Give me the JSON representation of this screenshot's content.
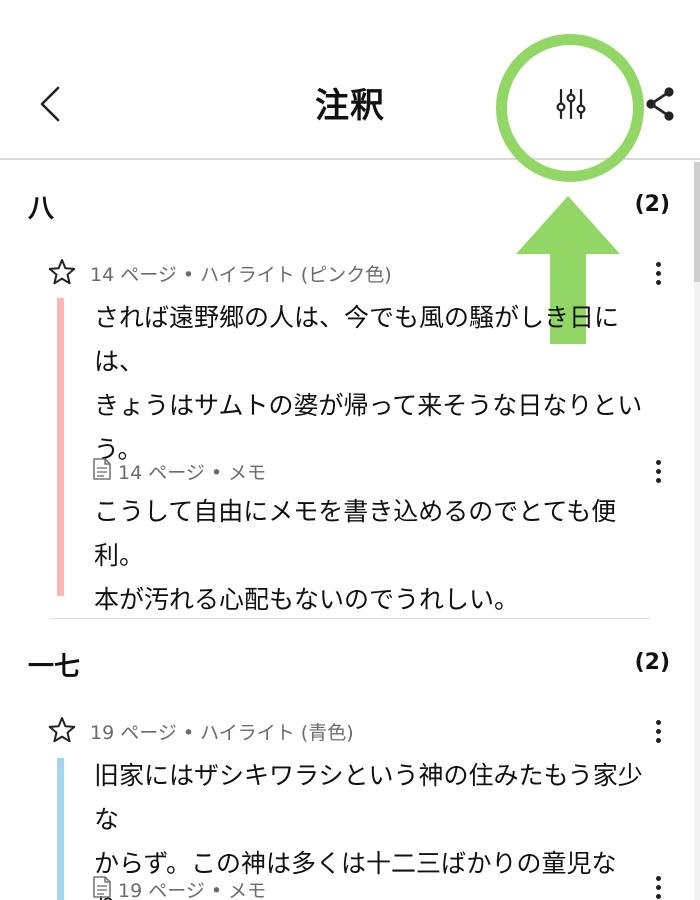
{
  "header": {
    "title": "注釈",
    "icons": {
      "back": "chevron-left-icon",
      "filter": "sliders-icon",
      "share": "share-icon"
    }
  },
  "annotation_overlay": {
    "ring_color": "#92d765",
    "arrow_color": "#92d765"
  },
  "sections": [
    {
      "name": "八",
      "count": "(2)",
      "highlight": {
        "meta": "14 ページ • ハイライト (ピンク色)",
        "color": "#ffb5b8",
        "lines": [
          "されば遠野郷の人は、今でも風の騒がしき日には、",
          "きょうはサムトの婆が帰って来そうな日なりとい",
          "う。"
        ]
      },
      "memo": {
        "meta": "14 ページ • メモ",
        "lines": [
          "こうして自由にメモを書き込めるのでとても便利。",
          "本が汚れる心配もないのでうれしい。"
        ]
      }
    },
    {
      "name": "一七",
      "count": "(2)",
      "highlight": {
        "meta": "19 ページ • ハイライト (青色)",
        "color": "#a7d3f0",
        "lines": [
          "旧家にはザシキワラシという神の住みたもう家少な",
          "からず。この神は多くは十二三ばかりの童児なり。"
        ]
      },
      "memo": {
        "meta": "19 ページ • メモ"
      }
    }
  ]
}
